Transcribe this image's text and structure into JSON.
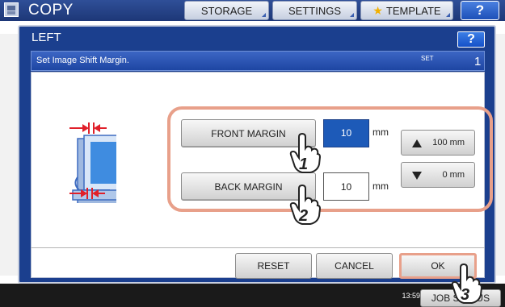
{
  "app": {
    "title": "COPY",
    "tabs": [
      {
        "label": "STORAGE"
      },
      {
        "label": "SETTINGS"
      },
      {
        "label": "TEMPLATE"
      }
    ],
    "help_label": "?"
  },
  "dialog": {
    "title": "LEFT",
    "help_label": "?",
    "instruction": "Set Image Shift Margin.",
    "set_label": "SET",
    "set_value": "1"
  },
  "front_margin": {
    "button_label": "FRONT MARGIN",
    "value": "10",
    "unit": "mm"
  },
  "back_margin": {
    "button_label": "BACK MARGIN",
    "value": "10",
    "unit": "mm"
  },
  "stepper": {
    "up_label": "100 mm",
    "down_label": "0 mm"
  },
  "actions": {
    "reset_label": "RESET",
    "cancel_label": "CANCEL",
    "ok_label": "OK"
  },
  "status": {
    "time": "13:59",
    "job_label": "JOB STATUS"
  },
  "callouts": {
    "step1": "1",
    "step2": "2",
    "step3": "3"
  },
  "colors": {
    "accent_blue": "#1b3f8e",
    "highlight": "#e8a08a",
    "selected_field": "#1d5ab8"
  }
}
